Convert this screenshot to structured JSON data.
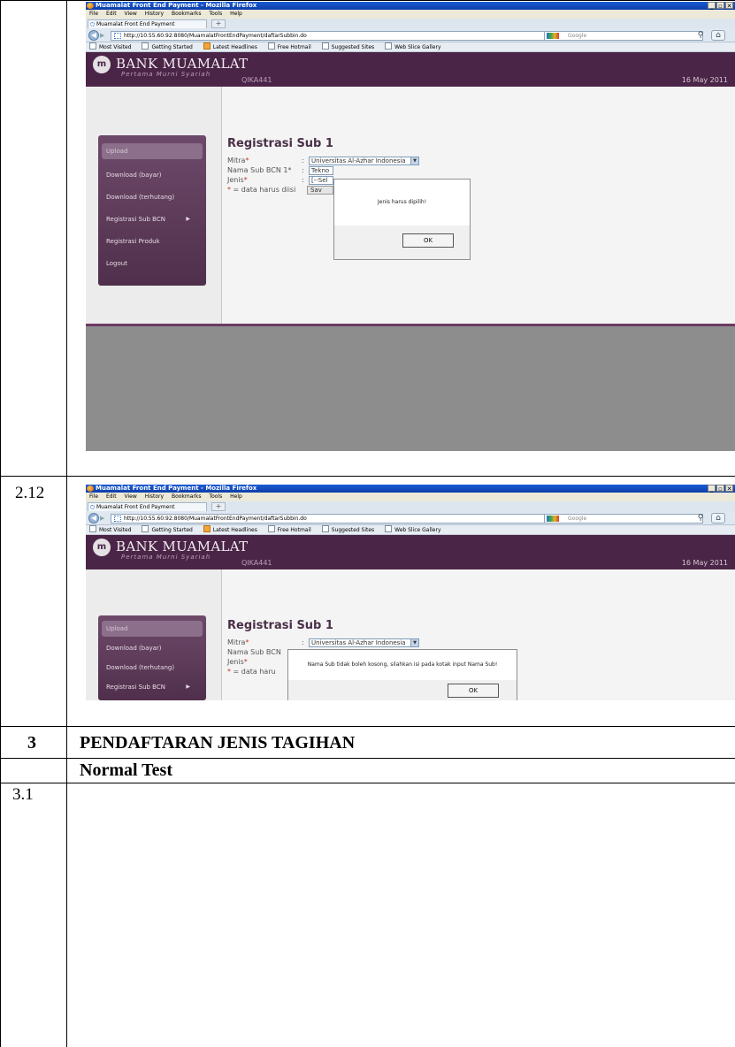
{
  "rows": {
    "r212": "2.12",
    "r3": "3",
    "r31": "3.1"
  },
  "section": {
    "title": "PENDAFTARAN JENIS TAGIHAN",
    "subtitle": "Normal Test"
  },
  "browser": {
    "window_title": "Muamalat Front End Payment - Mozilla Firefox",
    "menu": [
      "File",
      "Edit",
      "View",
      "History",
      "Bookmarks",
      "Tools",
      "Help"
    ],
    "tab_label": "Muamalat Front End Payment",
    "newtab": "+",
    "url": "http://10.55.60.92:8080/MuamalatFrontEndPayment/daftarSubbin.do",
    "search_placeholder": "Google",
    "bookmarks": [
      "Most Visited",
      "Getting Started",
      "Latest Headlines",
      "Free Hotmail",
      "Suggested Sites",
      "Web Slice Gallery"
    ],
    "win_buttons": [
      "_",
      "▫",
      "✕"
    ]
  },
  "site": {
    "brand": "BANK MUAMALAT",
    "tagline": "Pertama Murni Syariah",
    "user": "QIKA441",
    "date": "16 May 2011",
    "menu": [
      "Upload",
      "Download (bayar)",
      "Download (terhutang)",
      "Registrasi Sub BCN",
      "Registrasi Produk",
      "Logout"
    ],
    "arrow": "▶"
  },
  "form": {
    "title": "Registrasi Sub 1",
    "mitra_label": "Mitra",
    "mitra_value": "Universitas Al-Azhar Indonesia",
    "nama_label": "Nama Sub BCN 1",
    "jenis_label": "Jenis",
    "legend": "= data harus diisi",
    "star": "*",
    "colon": ":",
    "shot1": {
      "nama_label_visible": "Nama Sub BCN 1*",
      "nama_value": "Tekno",
      "jenis_value": "[--Sel",
      "legend_visible": "= data harus diisi",
      "save_label": "Sav",
      "dialog_message": "Jenis harus dipilih!",
      "ok_label": "OK"
    },
    "shot2": {
      "nama_label_visible": "Nama Sub BCN",
      "legend_visible": "= data haru",
      "dialog_message": "Nama Sub tidak boleh kosong, silahkan isi pada kotak input Nama Sub!",
      "ok_label": "OK"
    }
  },
  "colors": {
    "site_purple": "#4b2547",
    "sidebar_purple": "#5e3b5a",
    "footer_grey": "#8d8d8d"
  }
}
